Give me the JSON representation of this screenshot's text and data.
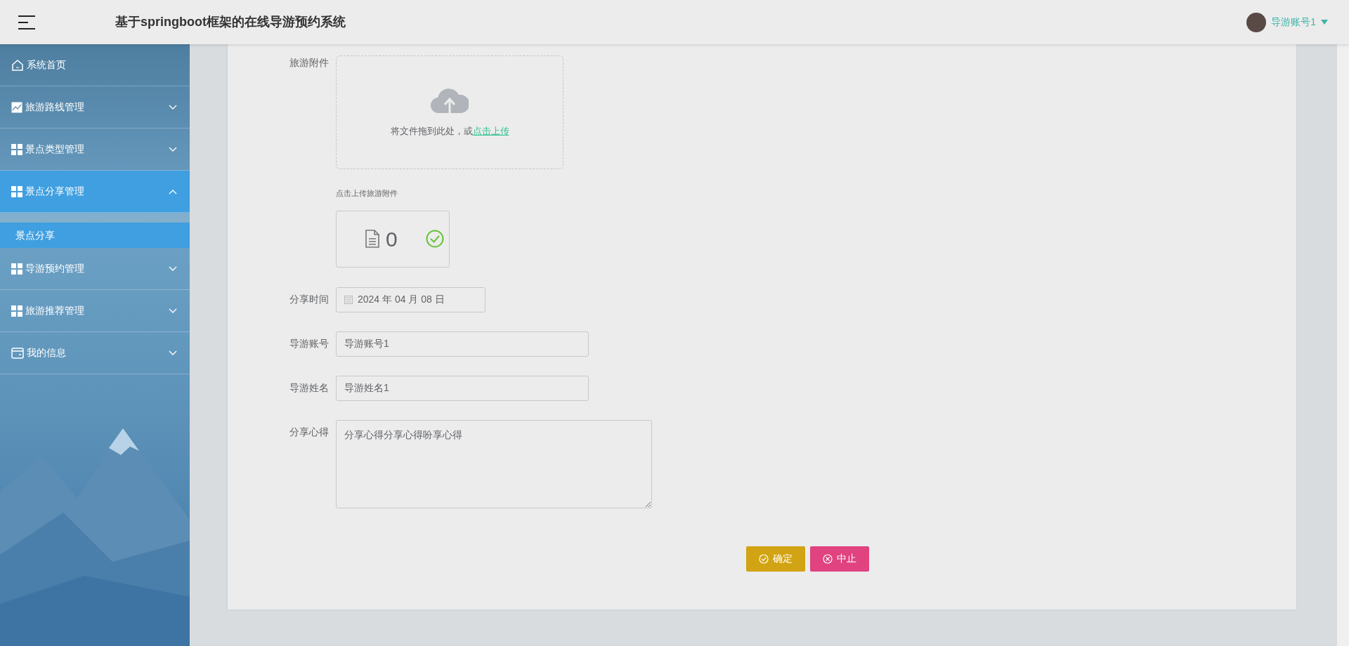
{
  "header": {
    "title": "基于springboot框架的在线导游预约系统",
    "user": "导游账号1"
  },
  "sidebar": {
    "items": [
      {
        "label": "系统首页",
        "kind": "home",
        "selected": false
      },
      {
        "label": "旅游路线管理",
        "kind": "chart",
        "expanded": false,
        "selected": false
      },
      {
        "label": "景点类型管理",
        "kind": "grid",
        "expanded": false,
        "selected": false
      },
      {
        "label": "景点分享管理",
        "kind": "grid",
        "expanded": true,
        "selected": true,
        "children": [
          {
            "label": "景点分享",
            "selected": true
          }
        ]
      },
      {
        "label": "导游预约管理",
        "kind": "grid",
        "expanded": false,
        "selected": false
      },
      {
        "label": "旅游推荐管理",
        "kind": "grid",
        "expanded": false,
        "selected": false
      },
      {
        "label": "我的信息",
        "kind": "card",
        "expanded": false,
        "selected": false
      }
    ]
  },
  "form": {
    "upload": {
      "label": "旅游附件",
      "prompt": "将文件拖到此处，或",
      "link": "点击上传",
      "hint": "点击上传旅游附件",
      "file_count": "0",
      "uploaded": true
    },
    "date": {
      "label": "分享时间",
      "value": "2024 年 04 月 08 日"
    },
    "fields": [
      {
        "label": "导游账号",
        "value": "导游账号1"
      },
      {
        "label": "导游姓名",
        "value": "导游姓名1"
      }
    ],
    "notes": {
      "label": "分享心得",
      "value": "分享心得分享心得吩享心得"
    },
    "buttons": [
      {
        "label": "确定",
        "kind": "confirm"
      },
      {
        "label": "中止",
        "kind": "cancel"
      }
    ]
  }
}
